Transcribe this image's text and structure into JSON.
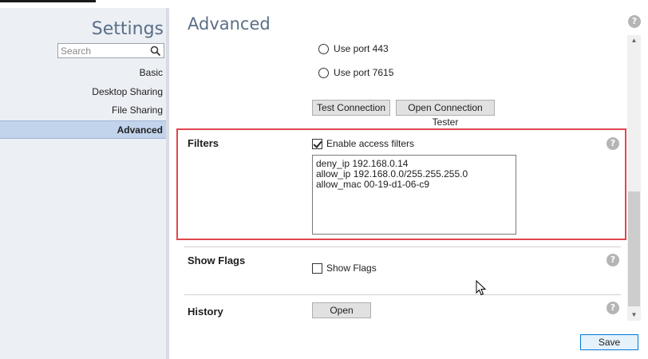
{
  "sidebar": {
    "title": "Settings",
    "search_placeholder": "Search",
    "items": [
      {
        "label": "Basic"
      },
      {
        "label": "Desktop Sharing"
      },
      {
        "label": "File Sharing"
      },
      {
        "label": "Advanced",
        "active": true
      }
    ]
  },
  "main": {
    "title": "Advanced",
    "connection": {
      "options": [
        {
          "label": "Use port 443",
          "selected": false
        },
        {
          "label": "Use port 7615",
          "selected": false
        }
      ],
      "test_button": "Test Connection",
      "tester_button": "Open Connection Tester"
    },
    "filters": {
      "label": "Filters",
      "enable_label": "Enable access filters",
      "enabled": true,
      "lines": [
        "deny_ip 192.168.0.14",
        "allow_ip 192.168.0.0/255.255.255.0",
        "allow_mac 00-19-d1-06-c9"
      ]
    },
    "show_flags": {
      "label": "Show Flags",
      "checkbox_label": "Show Flags",
      "checked": false
    },
    "history": {
      "label": "History",
      "open_button": "Open"
    },
    "help_glyph": "?",
    "save_button": "Save"
  },
  "colors": {
    "accent_title": "#5a6f87",
    "highlight_border": "#e0474c",
    "active_nav": "#c2d3ec"
  },
  "icons": [
    "search-icon",
    "help-icon",
    "mouse-cursor-icon"
  ]
}
